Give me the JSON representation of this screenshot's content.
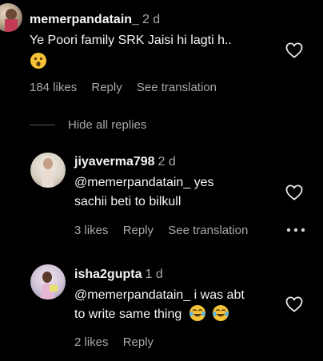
{
  "colors": {
    "background": "#000000",
    "primary_text": "#f5f5f5",
    "secondary_text": "#a8a8a8"
  },
  "comments": [
    {
      "username": "memerpandatain_",
      "time": "2 d",
      "text": "Ye Poori family SRK Jaisi hi lagti h..",
      "emoji": "😮",
      "likes": "184 likes",
      "reply_label": "Reply",
      "translation_label": "See translation",
      "avatar_icon": "avatar-photo"
    }
  ],
  "hide_replies_label": "Hide all replies",
  "replies": [
    {
      "username": "jiyaverma798",
      "time": "2 d",
      "text_line1": "@memerpandatain_ yes",
      "text_line2": "sachii beti to bilkull",
      "likes": "3 likes",
      "reply_label": "Reply",
      "translation_label": "See translation",
      "more_icon": "more-dots-icon"
    },
    {
      "username": "isha2gupta",
      "time": "1 d",
      "text_line1": "@memerpandatain_ i was abt",
      "text_line2": "to write same thing",
      "emoji": "😂 😂",
      "likes": "2 likes",
      "reply_label": "Reply"
    }
  ]
}
